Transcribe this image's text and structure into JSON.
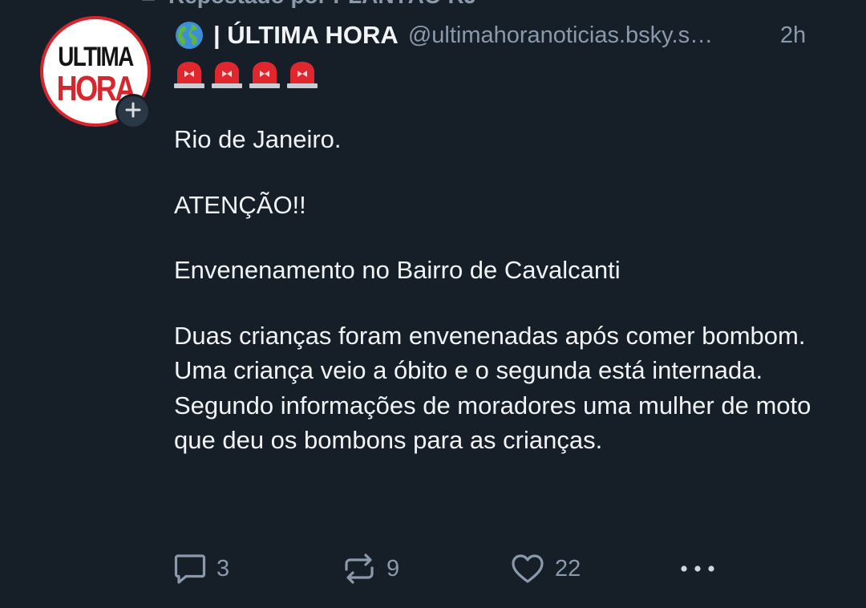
{
  "repost": {
    "label": "Repostado por PLANTÃO RJ",
    "icon": "repost-icon"
  },
  "author": {
    "avatar_line1": "ULTIMA",
    "avatar_line2": "HORA",
    "avatar_border_color": "#d7262e",
    "globe_icon": "globe-americas-icon",
    "display_name": "| ÚLTIMA HORA",
    "handle": "@ultimahoranoticias.bsky.s…",
    "time": "2h",
    "follow_icon": "plus-icon"
  },
  "sirens": {
    "icon": "siren-icon",
    "count": 4
  },
  "post": {
    "line1": "Rio de Janeiro.",
    "line2": "ATENÇÃO!!",
    "line3": "Envenenamento no Bairro de Cavalcanti",
    "line4": "Duas crianças foram envenenadas após comer bombom.",
    "line5": "Uma criança veio a óbito e o segunda está internada.",
    "line6": "Segundo informações de moradores uma mulher de moto que deu os bombons para as crianças."
  },
  "actions": {
    "reply_count": "3",
    "repost_count": "9",
    "like_count": "22",
    "reply_icon": "reply-bubble-icon",
    "repost_icon": "repost-icon",
    "like_icon": "heart-icon",
    "more_icon": "more-dots-icon"
  },
  "colors": {
    "background": "#161e27",
    "text": "#f1f3f5",
    "muted": "#8a99ab",
    "siren_red": "#e0272e"
  }
}
